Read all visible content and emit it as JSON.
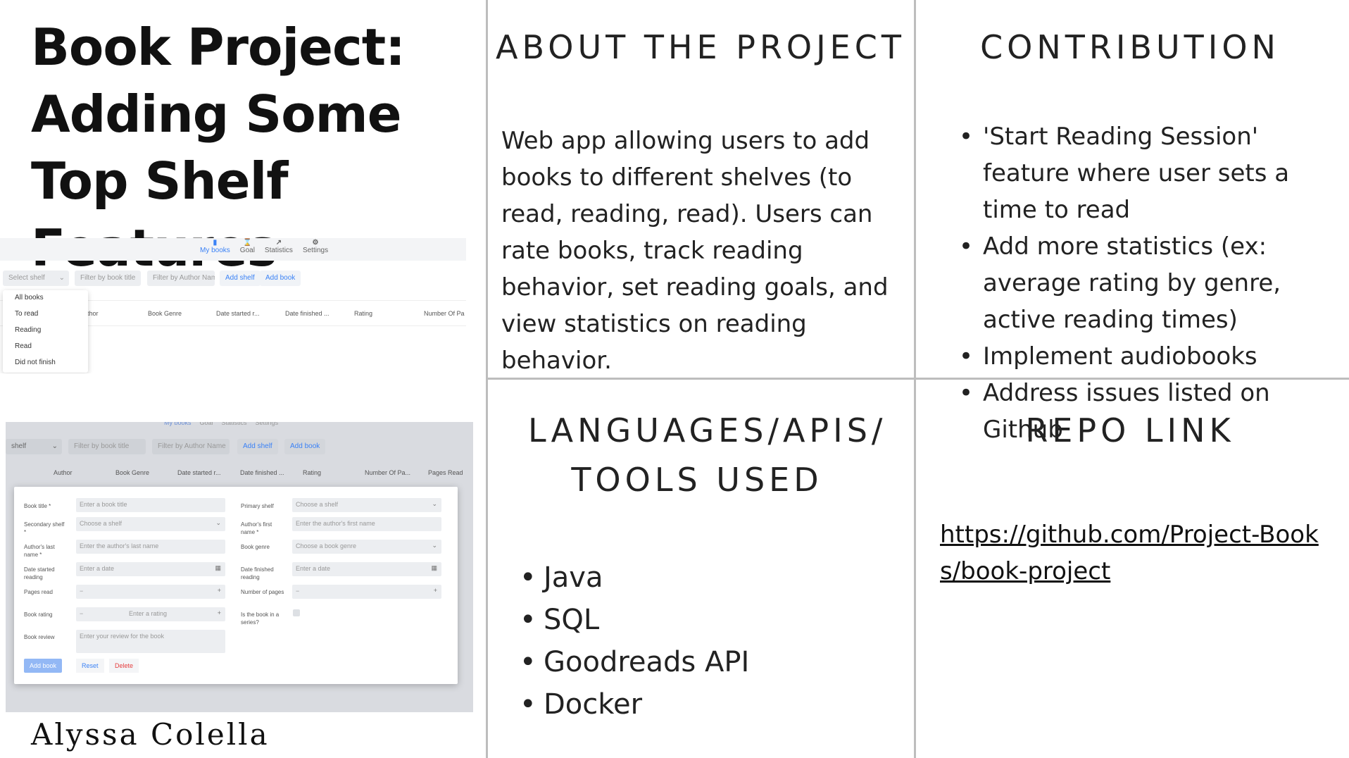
{
  "title": "Book Project: Adding Some Top Shelf Features",
  "author": "Alyssa Colella",
  "about": {
    "heading": "ABOUT THE PROJECT",
    "text": "Web app allowing users to add books to different shelves (to read, reading, read).  Users can rate books, track reading behavior, set reading goals, and view statistics on reading behavior."
  },
  "contribution": {
    "heading": "CONTRIBUTION",
    "items": [
      "'Start Reading Session' feature where user sets a time to read",
      "Add more statistics (ex: average rating by genre, active reading times)",
      "Implement audiobooks",
      "Address issues listed on Github"
    ]
  },
  "languages": {
    "heading": "LANGUAGES/APIS/ TOOLS USED",
    "items": [
      "Java",
      "SQL",
      "Goodreads API",
      "Docker"
    ]
  },
  "repo": {
    "heading": "REPO LINK",
    "url": "https://github.com/Project-Books/book-project"
  },
  "app": {
    "nav": [
      "My books",
      "Goal",
      "Statistics",
      "Settings"
    ],
    "select_shelf": "Select shelf",
    "select_shelf_cut": "shelf",
    "filter_title": "Filter by book title",
    "filter_author": "Filter by Author Name",
    "add_shelf": "Add shelf",
    "add_book": "Add book",
    "shelf_options": [
      "All books",
      "To read",
      "Reading",
      "Read",
      "Did not finish"
    ],
    "columns1": [
      "thor",
      "Book Genre",
      "Date started r...",
      "Date finished ...",
      "Rating",
      "Number Of Pa"
    ],
    "columns2": [
      "Author",
      "Book Genre",
      "Date started r...",
      "Date finished ...",
      "Rating",
      "Number Of Pa...",
      "Pages Read"
    ],
    "form": {
      "book_title": "Book title *",
      "book_title_ph": "Enter a book title",
      "primary_shelf": "Primary shelf",
      "choose_shelf": "Choose a shelf",
      "secondary_shelf": "Secondary shelf *",
      "first_name": "Author's first name *",
      "first_name_ph": "Enter the author's first name",
      "last_name": "Author's last name *",
      "last_name_ph": "Enter the author's last name",
      "genre": "Book genre",
      "genre_ph": "Choose a book genre",
      "date_started": "Date started reading",
      "date_finished": "Date finished reading",
      "date_ph": "Enter a date",
      "pages_read": "Pages read",
      "num_pages": "Number of pages",
      "rating": "Book rating",
      "rating_ph": "Enter a rating",
      "series": "Is the book in a series?",
      "review": "Book review",
      "review_ph": "Enter your review for the book",
      "add": "Add book",
      "reset": "Reset",
      "delete": "Delete"
    }
  }
}
